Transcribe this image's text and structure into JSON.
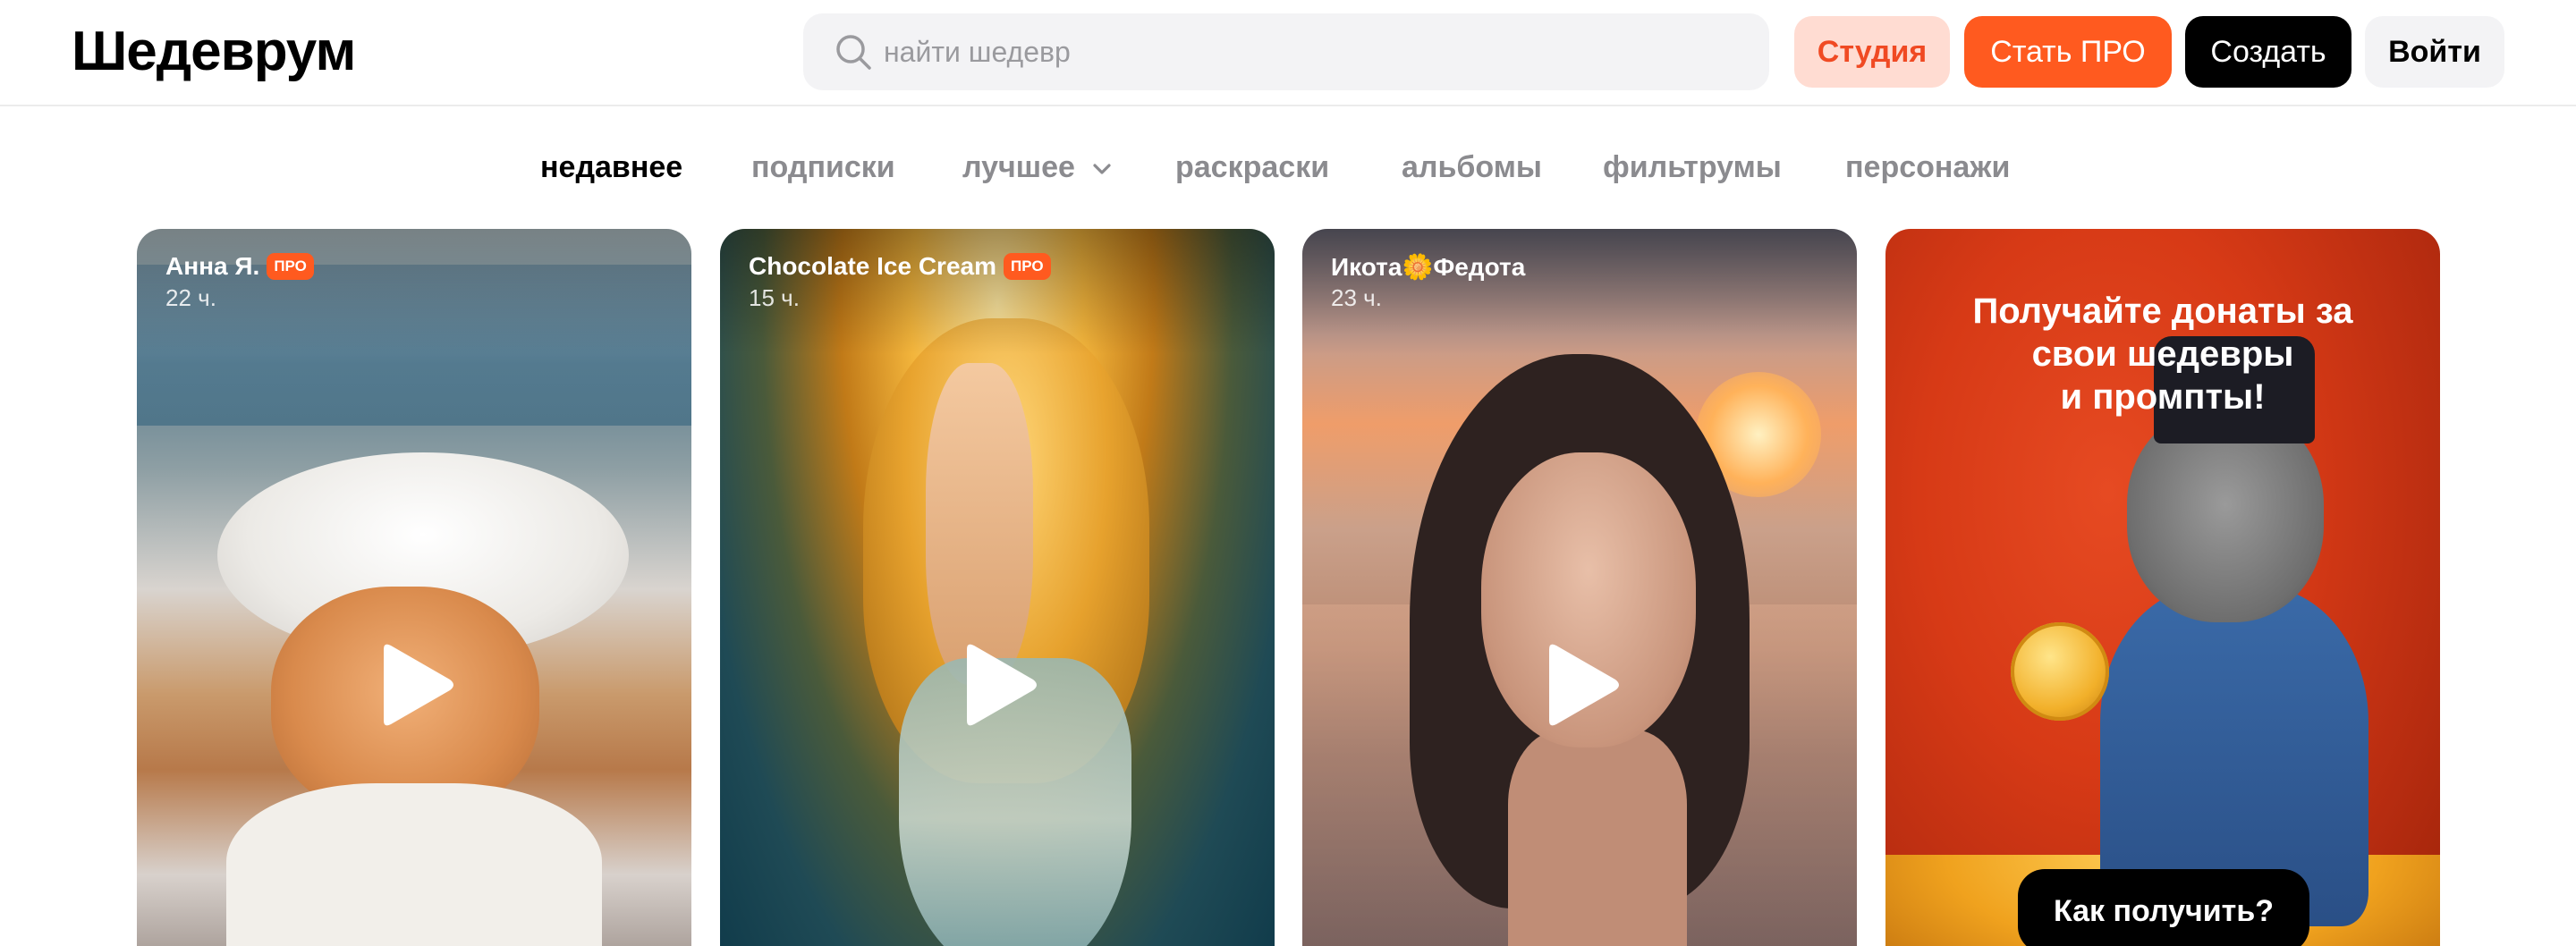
{
  "header": {
    "logo": "Шедеврум",
    "search": {
      "placeholder": "найти шедевр",
      "value": ""
    },
    "buttons": {
      "studio": "Студия",
      "pro": "Стать ПРО",
      "create": "Создать",
      "login": "Войти"
    }
  },
  "tabs": [
    {
      "label": "недавнее",
      "active": true
    },
    {
      "label": "подписки",
      "active": false
    },
    {
      "label": "лучшее",
      "active": false,
      "dropdown": true
    },
    {
      "label": "раскраски",
      "active": false
    },
    {
      "label": "альбомы",
      "active": false
    },
    {
      "label": "фильтрумы",
      "active": false
    },
    {
      "label": "персонажи",
      "active": false
    }
  ],
  "cards": [
    {
      "author": "Анна Я.",
      "badge": "ПРО",
      "time": "22 ч.",
      "type": "video"
    },
    {
      "author": "Chocolate Ice Cream",
      "badge": "ПРО",
      "time": "15 ч.",
      "type": "video"
    },
    {
      "author": "Икота🌼Федота",
      "badge": "",
      "time": "23 ч.",
      "type": "video"
    }
  ],
  "promo": {
    "line1": "Получайте донаты за",
    "line2": "свои шедевры",
    "line3": "и промпты!",
    "button": "Как получить?"
  },
  "colors": {
    "accent": "#ff5a1f",
    "studio_bg": "#ffdcd2",
    "studio_text": "#f04a23",
    "tab_inactive": "#8b8b8f",
    "search_bg": "#f3f3f5"
  },
  "icons": [
    "search-icon",
    "chevron-down-icon",
    "play-icon"
  ]
}
